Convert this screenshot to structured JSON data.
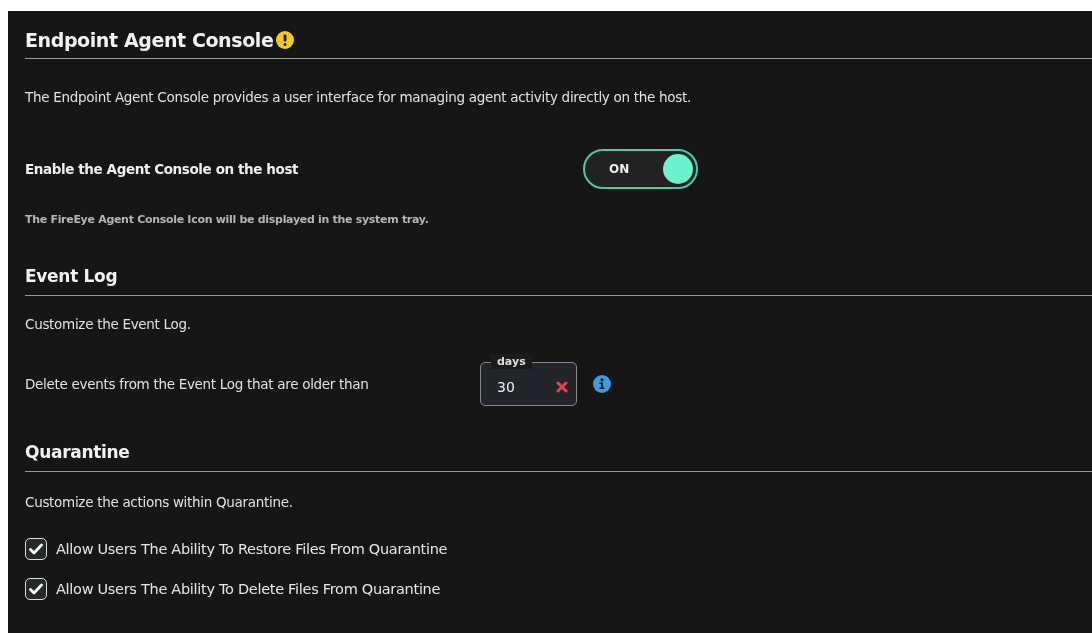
{
  "title": "Endpoint Agent Console",
  "description": "The Endpoint Agent Console provides a user interface for managing agent activity directly on the host.",
  "console_toggle": {
    "label": "Enable the Agent Console on the host",
    "state_text": "ON",
    "on": true,
    "hint": "The FireEye Agent Console Icon will be displayed in the system tray."
  },
  "event_log": {
    "heading": "Event Log",
    "description": "Customize the Event Log.",
    "retention_label": "Delete events from the Event Log that are older than",
    "field_label": "days",
    "value": "30"
  },
  "quarantine": {
    "heading": "Quarantine",
    "description": "Customize the actions within Quarantine.",
    "options": [
      {
        "label": "Allow Users The Ability To Restore Files From Quarantine",
        "checked": true
      },
      {
        "label": "Allow Users The Ability To Delete Files From Quarantine",
        "checked": true
      }
    ]
  }
}
